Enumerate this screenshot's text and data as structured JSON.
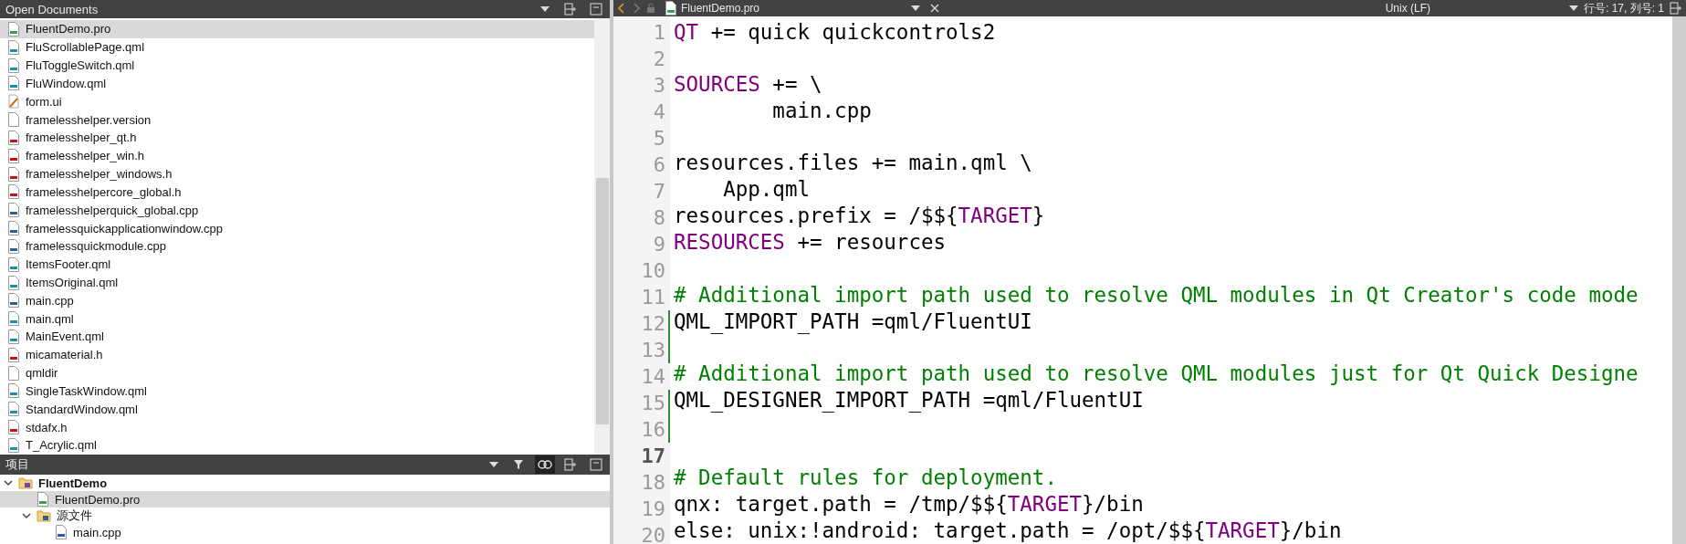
{
  "open_documents": {
    "title": "Open Documents",
    "items": [
      {
        "name": "FluentDemo.pro",
        "kind": "pro",
        "selected": true
      },
      {
        "name": "FluScrollablePage.qml",
        "kind": "qml",
        "selected": false
      },
      {
        "name": "FluToggleSwitch.qml",
        "kind": "qml",
        "selected": false
      },
      {
        "name": "FluWindow.qml",
        "kind": "qml",
        "selected": false
      },
      {
        "name": "form.ui",
        "kind": "ui",
        "selected": false
      },
      {
        "name": "framelesshelper.version",
        "kind": "plain",
        "selected": false
      },
      {
        "name": "framelesshelper_qt.h",
        "kind": "h",
        "selected": false
      },
      {
        "name": "framelesshelper_win.h",
        "kind": "h",
        "selected": false
      },
      {
        "name": "framelesshelper_windows.h",
        "kind": "h",
        "selected": false
      },
      {
        "name": "framelesshelpercore_global.h",
        "kind": "h",
        "selected": false
      },
      {
        "name": "framelesshelperquick_global.cpp",
        "kind": "cpp",
        "selected": false
      },
      {
        "name": "framelessquickapplicationwindow.cpp",
        "kind": "cpp",
        "selected": false
      },
      {
        "name": "framelessquickmodule.cpp",
        "kind": "cpp",
        "selected": false
      },
      {
        "name": "ItemsFooter.qml",
        "kind": "qml",
        "selected": false
      },
      {
        "name": "ItemsOriginal.qml",
        "kind": "qml",
        "selected": false
      },
      {
        "name": "main.cpp",
        "kind": "cpp",
        "selected": false
      },
      {
        "name": "main.qml",
        "kind": "qml",
        "selected": false
      },
      {
        "name": "MainEvent.qml",
        "kind": "qml",
        "selected": false
      },
      {
        "name": "micamaterial.h",
        "kind": "h",
        "selected": false
      },
      {
        "name": "qmldir",
        "kind": "plain",
        "selected": false
      },
      {
        "name": "SingleTaskWindow.qml",
        "kind": "qml",
        "selected": false
      },
      {
        "name": "StandardWindow.qml",
        "kind": "qml",
        "selected": false
      },
      {
        "name": "stdafx.h",
        "kind": "h",
        "selected": false
      },
      {
        "name": "T_Acrylic.qml",
        "kind": "qml",
        "selected": false
      }
    ]
  },
  "project_panel": {
    "title": "项目",
    "tree": [
      {
        "name": "FluentDemo",
        "kind": "project",
        "expanded": true,
        "selected": false,
        "children": [
          {
            "name": "FluentDemo.pro",
            "kind": "pro",
            "selected": true
          },
          {
            "name": "源文件",
            "kind": "folder",
            "expanded": true,
            "selected": false,
            "children": [
              {
                "name": "main.cpp",
                "kind": "cpp",
                "selected": false
              }
            ]
          }
        ]
      }
    ]
  },
  "editor_toolbar": {
    "file_name": "FluentDemo.pro",
    "line_ending": "Unix (LF)",
    "position": "行号: 17, 列号: 1"
  },
  "editor": {
    "lines": [
      {
        "number": "1",
        "current": false,
        "changed": false,
        "tokens": [
          {
            "kind": "keyword",
            "text": "QT"
          },
          {
            "kind": "text",
            "text": " += quick quickcontrols2"
          }
        ]
      },
      {
        "number": "2",
        "current": false,
        "changed": false
      },
      {
        "number": "3",
        "current": false,
        "changed": false,
        "tokens": [
          {
            "kind": "keyword",
            "text": "SOURCES"
          },
          {
            "kind": "text",
            "text": " += \\"
          }
        ]
      },
      {
        "number": "4",
        "current": false,
        "changed": false,
        "tokens": [
          {
            "kind": "text",
            "text": "        main.cpp"
          }
        ]
      },
      {
        "number": "5",
        "current": false,
        "changed": false
      },
      {
        "number": "6",
        "current": false,
        "changed": false,
        "tokens": [
          {
            "kind": "text",
            "text": "resources.files += main.qml \\"
          }
        ]
      },
      {
        "number": "7",
        "current": false,
        "changed": false,
        "tokens": [
          {
            "kind": "text",
            "text": "    App.qml"
          }
        ]
      },
      {
        "number": "8",
        "current": false,
        "changed": false,
        "tokens": [
          {
            "kind": "text",
            "text": "resources.prefix = /$${"
          },
          {
            "kind": "keyword",
            "text": "TARGET"
          },
          {
            "kind": "text",
            "text": "}"
          }
        ]
      },
      {
        "number": "9",
        "current": false,
        "changed": false,
        "tokens": [
          {
            "kind": "keyword",
            "text": "RESOURCES"
          },
          {
            "kind": "text",
            "text": " += resources"
          }
        ]
      },
      {
        "number": "10",
        "current": false,
        "changed": false
      },
      {
        "number": "11",
        "current": false,
        "changed": false,
        "tokens": [
          {
            "kind": "comment",
            "text": "# Additional import path used to resolve QML modules in Qt Creator's code mode"
          }
        ]
      },
      {
        "number": "12",
        "current": false,
        "changed": true,
        "tokens": [
          {
            "kind": "text",
            "text": "QML_IMPORT_PATH =qml/FluentUI"
          }
        ]
      },
      {
        "number": "13",
        "current": false,
        "changed": true
      },
      {
        "number": "14",
        "current": false,
        "changed": false,
        "tokens": [
          {
            "kind": "comment",
            "text": "# Additional import path used to resolve QML modules just for Qt Quick Designe"
          }
        ]
      },
      {
        "number": "15",
        "current": false,
        "changed": true,
        "tokens": [
          {
            "kind": "text",
            "text": "QML_DESIGNER_IMPORT_PATH =qml/FluentUI"
          }
        ]
      },
      {
        "number": "16",
        "current": false,
        "changed": true
      },
      {
        "number": "17",
        "current": true,
        "changed": false
      },
      {
        "number": "18",
        "current": false,
        "changed": false,
        "tokens": [
          {
            "kind": "comment",
            "text": "# Default rules for deployment."
          }
        ]
      },
      {
        "number": "19",
        "current": false,
        "changed": false,
        "tokens": [
          {
            "kind": "text",
            "text": "qnx: target.path = /tmp/$${"
          },
          {
            "kind": "keyword",
            "text": "TARGET"
          },
          {
            "kind": "text",
            "text": "}/bin"
          }
        ]
      },
      {
        "number": "20",
        "current": false,
        "changed": false,
        "tokens": [
          {
            "kind": "text",
            "text": "else: unix:!android: target.path = /opt/$${"
          },
          {
            "kind": "keyword",
            "text": "TARGET"
          },
          {
            "kind": "text",
            "text": "}/bin"
          }
        ]
      }
    ]
  }
}
